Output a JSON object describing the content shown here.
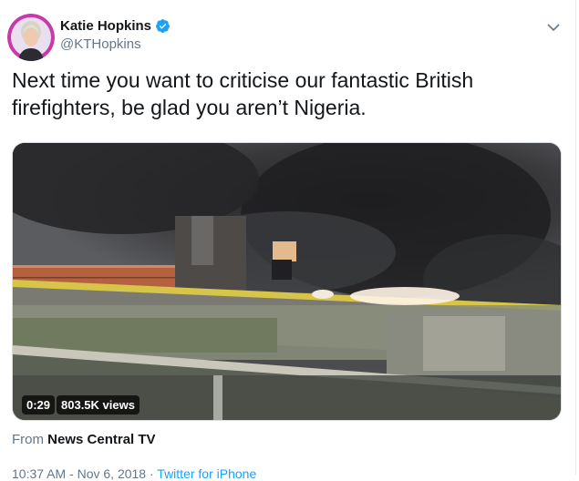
{
  "tweet": {
    "author": {
      "display_name": "Katie Hopkins",
      "handle": "@KTHopkins",
      "verified": true
    },
    "text": "Next time you want to criticise our fantastic British firefighters, be glad you aren’t Nigeria.",
    "media": {
      "duration": "0:29",
      "views": "803.5K views"
    },
    "source": {
      "prefix": "From",
      "name": "News Central TV"
    },
    "meta": {
      "timestamp": "10:37 AM - Nov 6, 2018",
      "separator": "·",
      "via": "Twitter for iPhone"
    }
  },
  "colors": {
    "link": "#1da1f2",
    "secondary_text": "#657786",
    "primary_text": "#14171a",
    "avatar_ring": "#c83aa8"
  },
  "icons": {
    "verified": "verified-badge-icon",
    "more": "chevron-down-icon"
  }
}
